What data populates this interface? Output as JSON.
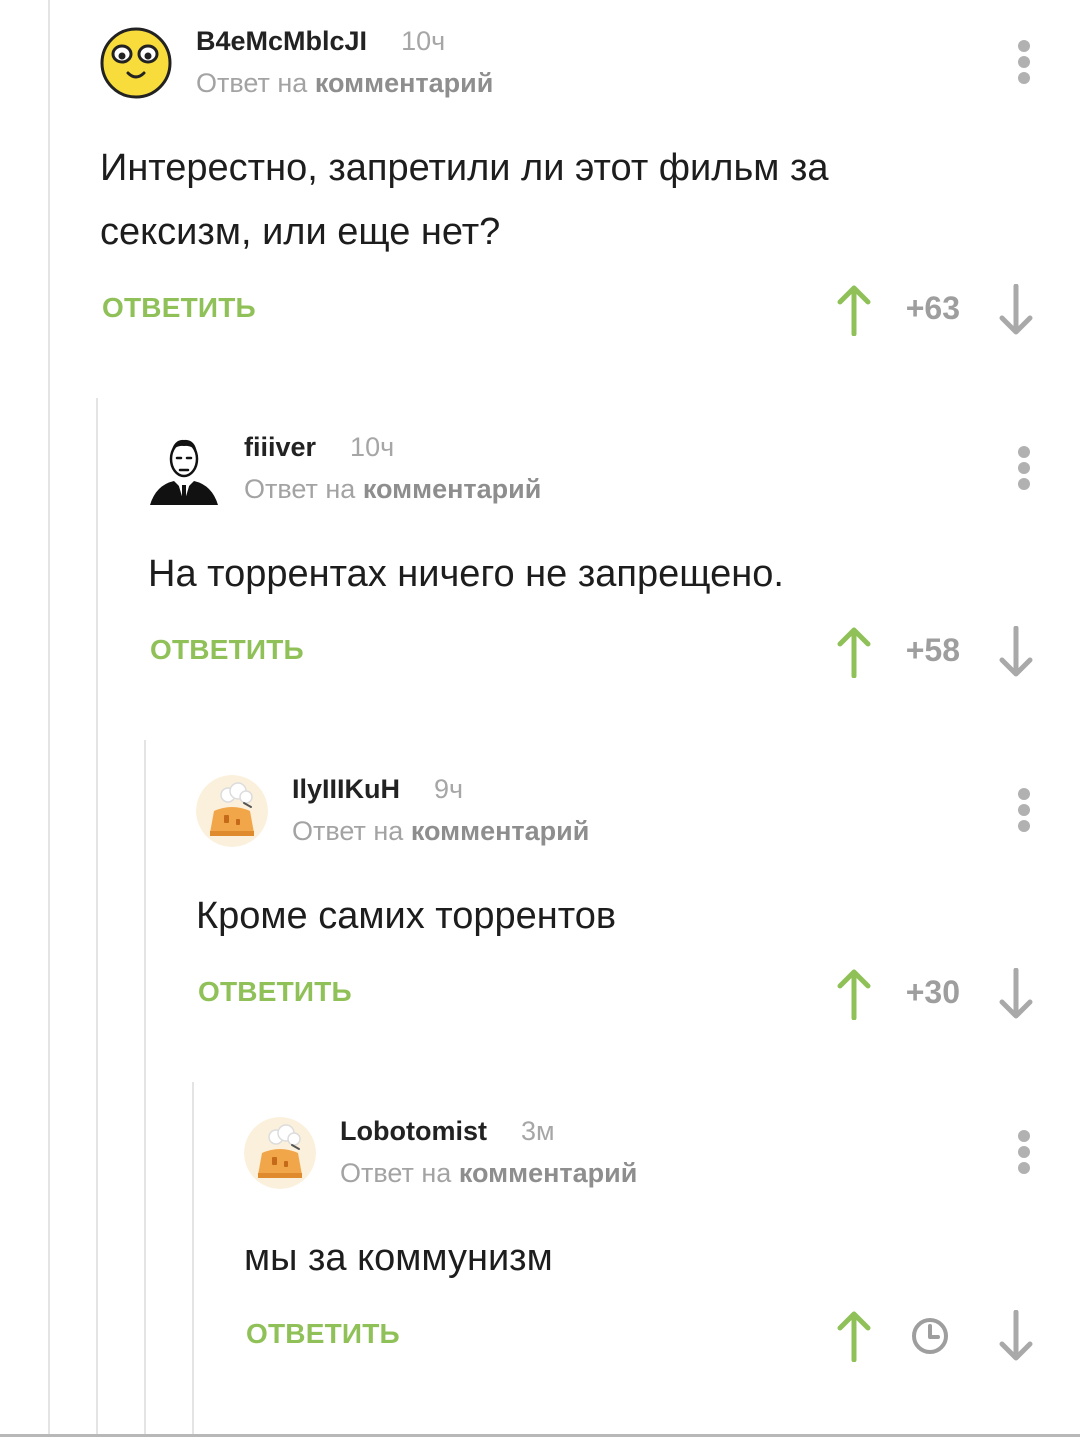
{
  "colors": {
    "accent_green": "#8fc158",
    "muted": "#a3a3a3",
    "text": "#1d1d1d"
  },
  "comments": [
    {
      "author": "B4eMcMblcJI",
      "time": "10ч",
      "reply_prefix": "Ответ на",
      "reply_target": "комментарий",
      "text_lines": [
        "Интерестно, запретили ли этот фильм за",
        "сексизм, или еще нет?"
      ],
      "reply_label": "ОТВЕТИТЬ",
      "score": "+63",
      "avatar_icon": "smiley-face-icon"
    },
    {
      "author": "fiiiver",
      "time": "10ч",
      "reply_prefix": "Ответ на",
      "reply_target": "комментарий",
      "text_lines": [
        "На торрентах ничего не запрещено."
      ],
      "reply_label": "ОТВЕТИТЬ",
      "score": "+58",
      "avatar_icon": "man-in-suit-icon"
    },
    {
      "author": "IlyIIIKuH",
      "time": "9ч",
      "reply_prefix": "Ответ на",
      "reply_target": "комментарий",
      "text_lines": [
        "Кроме самих торрентов"
      ],
      "reply_label": "ОТВЕТИТЬ",
      "score": "+30",
      "avatar_icon": "default-cake-avatar-icon"
    },
    {
      "author": "Lobotomist",
      "time": "3м",
      "reply_prefix": "Ответ на",
      "reply_target": "комментарий",
      "text_lines": [
        "мы за коммунизм"
      ],
      "reply_label": "ОТВЕТИТЬ",
      "score": "",
      "score_icon": "clock-icon",
      "avatar_icon": "default-cake-avatar-icon"
    }
  ]
}
